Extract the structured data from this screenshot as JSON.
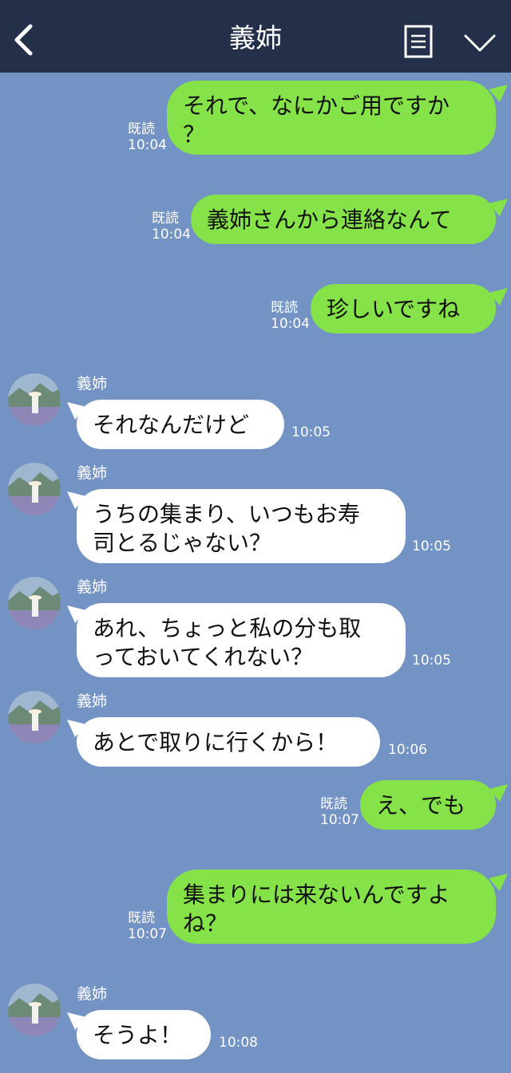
{
  "header": {
    "title": "義姉",
    "back_icon": "chevron-left-icon",
    "menu_icon": "list-icon",
    "dropdown_icon": "chevron-down-icon"
  },
  "messages": [
    {
      "dir": "out",
      "text": "それで、なにかご用ですか\n？",
      "read": "既読",
      "time": "10:04"
    },
    {
      "dir": "out",
      "text": "義姉さんから連絡なんて",
      "read": "既読",
      "time": "10:04"
    },
    {
      "dir": "out",
      "text": "珍しいですね",
      "read": "既読",
      "time": "10:04"
    },
    {
      "dir": "in",
      "sender": "義姉",
      "text": "それなんだけど",
      "time": "10:05"
    },
    {
      "dir": "in",
      "sender": "義姉",
      "text": "うちの集まり、いつもお寿\n司とるじゃない？",
      "time": "10:05"
    },
    {
      "dir": "in",
      "sender": "義姉",
      "text": "あれ、ちょっと私の分も取\nっておいてくれない？",
      "time": "10:05"
    },
    {
      "dir": "in",
      "sender": "義姉",
      "text": "あとで取りに行くから！",
      "time": "10:06"
    },
    {
      "dir": "out",
      "text": "え、でも",
      "read": "既読",
      "time": "10:07"
    },
    {
      "dir": "out",
      "text": "集まりには来ないんですよ\nね？",
      "read": "既読",
      "time": "10:07"
    },
    {
      "dir": "in",
      "sender": "義姉",
      "text": "そうよ！",
      "time": "10:08"
    }
  ],
  "colors": {
    "background": "#7293c3",
    "header": "#243049",
    "outgoing_bubble": "#85e249",
    "incoming_bubble": "#ffffff"
  }
}
